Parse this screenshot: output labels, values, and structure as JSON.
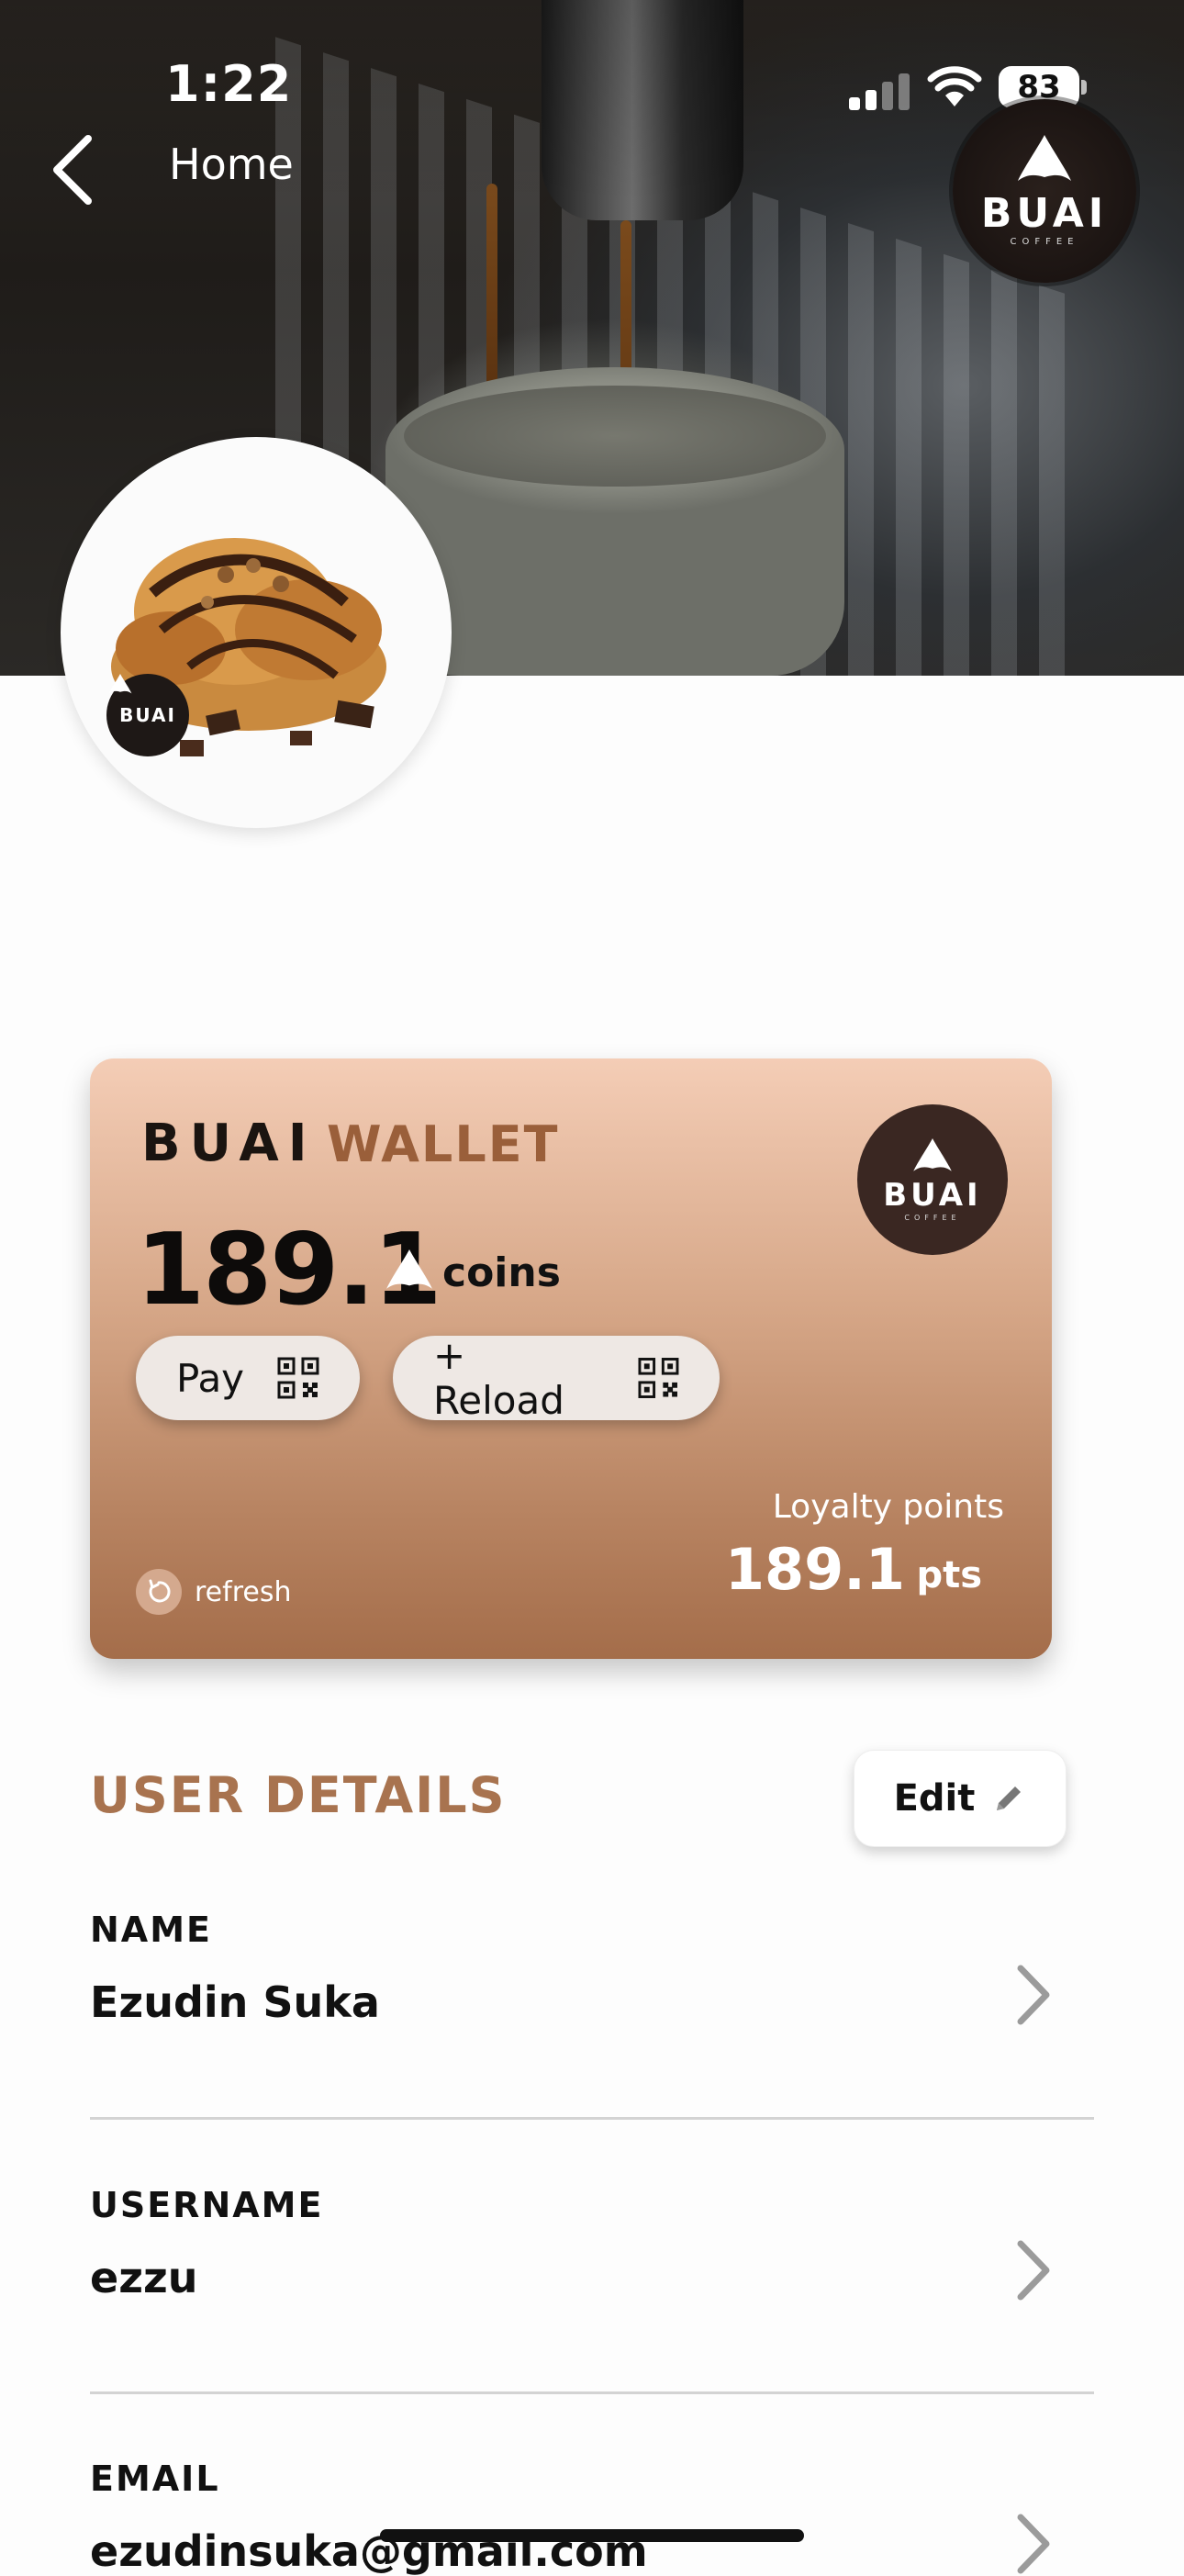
{
  "status_bar": {
    "time": "1:22",
    "battery": "83"
  },
  "nav": {
    "back_label": "Home"
  },
  "brand": {
    "name": "BUAI",
    "subtitle": "COFFEE"
  },
  "wallet": {
    "brand": "BUAI",
    "title": "WALLET",
    "balance": "189.1",
    "balance_unit": "coins",
    "pay_label": "Pay",
    "reload_label": "+ Reload",
    "refresh_label": "refresh",
    "loyalty_label": "Loyalty points",
    "loyalty_value": "189.1",
    "loyalty_unit": "pts"
  },
  "user_details": {
    "title": "USER DETAILS",
    "edit_label": "Edit",
    "fields": [
      {
        "label": "NAME",
        "value": "Ezudin Suka"
      },
      {
        "label": "USERNAME",
        "value": "ezzu"
      },
      {
        "label": "EMAIL",
        "value": "ezudinsuka@gmail.com"
      }
    ]
  },
  "colors": {
    "accent": "#a8734f",
    "wallet_top": "#f4cdb6",
    "wallet_bottom": "#a46d4a"
  }
}
